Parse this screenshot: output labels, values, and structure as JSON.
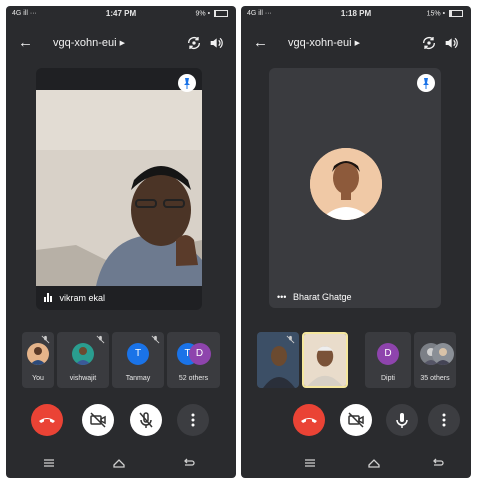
{
  "left": {
    "status": {
      "signal": "4G ill ···",
      "time": "1:47 PM",
      "battery": "9% •",
      "battery_level": 0.09
    },
    "header": {
      "meeting_code": "vgq-xohn-eui"
    },
    "main_speaker": {
      "name": "vikram ekal"
    },
    "participants": [
      {
        "label": "You",
        "muted": true
      },
      {
        "label": "vishwajit",
        "muted": true
      },
      {
        "label": "Tanmay",
        "initial": "T",
        "color": "#1a73e8",
        "muted": true
      },
      {
        "label": "52 others",
        "initials": [
          "T",
          "D"
        ],
        "colors": [
          "#1a73e8",
          "#8e44ad"
        ]
      }
    ]
  },
  "right": {
    "status": {
      "signal": "4G ill ···",
      "time": "1:18 PM",
      "battery": "15% •",
      "battery_level": 0.15
    },
    "header": {
      "meeting_code": "vgq-xohn-eui"
    },
    "main_speaker": {
      "name": "Bharat Ghatge"
    },
    "participants": [
      {
        "label": ""
      },
      {
        "label": ""
      },
      {
        "label": "Dipti",
        "initial": "D",
        "color": "#8e44ad"
      },
      {
        "label": "35 others"
      }
    ]
  },
  "colors": {
    "end_call": "#ea4335",
    "panel": "#2a2b2e",
    "tile": "#3a3b3f",
    "pin": "#1a73e8"
  }
}
